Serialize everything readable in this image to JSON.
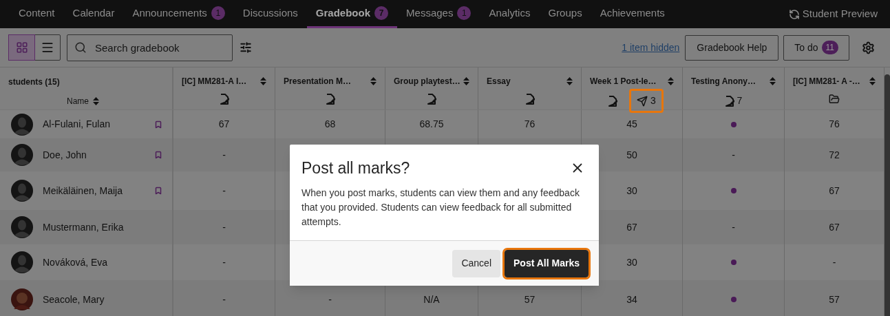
{
  "nav": {
    "tabs": [
      {
        "label": "Content",
        "selected": false
      },
      {
        "label": "Calendar",
        "selected": false
      },
      {
        "label": "Announcements",
        "badge": "1",
        "selected": false
      },
      {
        "label": "Discussions",
        "selected": false
      },
      {
        "label": "Gradebook",
        "badge": "7",
        "selected": true
      },
      {
        "label": "Messages",
        "badge": "1",
        "selected": false
      },
      {
        "label": "Analytics",
        "selected": false
      },
      {
        "label": "Groups",
        "selected": false
      },
      {
        "label": "Achievements",
        "selected": false
      }
    ],
    "student_preview": "Student Preview"
  },
  "toolbar": {
    "views": [
      {
        "kind": "grid",
        "selected": true
      },
      {
        "kind": "list",
        "selected": false
      }
    ],
    "search": {
      "placeholder": "Search gradebook"
    },
    "hidden_link": "1 item hidden",
    "help_button": "Gradebook Help",
    "todo": {
      "label": "To do",
      "badge": "11"
    }
  },
  "table": {
    "students_header": "students (15)",
    "name_header": "Name",
    "columns": [
      {
        "title": "[IC] MM281-A I…",
        "indicators": [
          {
            "kind": "graded"
          }
        ]
      },
      {
        "title": "Presentation M…",
        "indicators": [
          {
            "kind": "graded"
          }
        ]
      },
      {
        "title": "Group playtest…",
        "indicators": [
          {
            "kind": "graded"
          }
        ]
      },
      {
        "title": "Essay",
        "indicators": [
          {
            "kind": "graded"
          }
        ]
      },
      {
        "title": "Week 1 Post-le…",
        "indicators": [
          {
            "kind": "graded"
          },
          {
            "kind": "posted",
            "count": "3",
            "highlighted": true
          }
        ]
      },
      {
        "title": "Testing Anony…",
        "indicators": [
          {
            "kind": "graded",
            "count": "7"
          }
        ]
      },
      {
        "title": "[IC] MM281- A -…",
        "indicators": [
          {
            "kind": "folder"
          }
        ]
      }
    ],
    "rows": [
      {
        "name": "Al-Fulani, Fulan",
        "photo": false,
        "flagged": true,
        "cells": [
          "67",
          "68",
          "68.75",
          "76",
          "45",
          {
            "kind": "dot"
          },
          "76"
        ]
      },
      {
        "name": "Doe, John",
        "photo": false,
        "flagged": true,
        "cells": [
          "-",
          null,
          null,
          null,
          "50",
          "-",
          "72"
        ]
      },
      {
        "name": "Meikäläinen, Maija",
        "photo": false,
        "flagged": true,
        "cells": [
          "-",
          null,
          null,
          null,
          "30",
          {
            "kind": "dot"
          },
          "67"
        ]
      },
      {
        "name": "Mustermann, Erika",
        "photo": false,
        "flagged": false,
        "cells": [
          "-",
          null,
          null,
          null,
          "67",
          "-",
          "67"
        ]
      },
      {
        "name": "Nováková, Eva",
        "photo": false,
        "flagged": false,
        "cells": [
          "-",
          null,
          null,
          null,
          "30",
          {
            "kind": "dot"
          },
          "-"
        ]
      },
      {
        "name": "Seacole, Mary",
        "photo": true,
        "flagged": false,
        "cells": [
          "-",
          "-",
          "N/A",
          "57",
          "34",
          {
            "kind": "dot"
          },
          "57"
        ]
      }
    ]
  },
  "dialog": {
    "title": "Post all marks?",
    "body": "When you post marks, students can view them and any feedback that you provided. Students can view feedback for all submitted attempts.",
    "buttons": [
      {
        "kind": "secondary",
        "label": "Cancel",
        "highlighted": false
      },
      {
        "kind": "primary",
        "label": "Post All Marks",
        "highlighted": true
      }
    ]
  }
}
